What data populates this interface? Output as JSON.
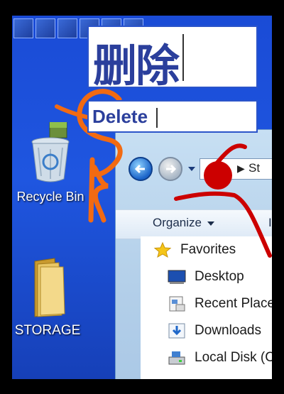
{
  "desktop": {
    "recycle_bin_label": "Recycle Bin",
    "storage_label": "STORAGE"
  },
  "overlay": {
    "chinese_label": "删除",
    "english_label": "Delete"
  },
  "explorer": {
    "address_text": "St",
    "toolbar": {
      "organize_label": "Organize",
      "include_label": "In"
    },
    "nav_pane": {
      "items": [
        {
          "label": "Favorites",
          "icon": "star-icon"
        },
        {
          "label": "Desktop",
          "icon": "desktop-icon"
        },
        {
          "label": "Recent Places",
          "icon": "recent-places-icon"
        },
        {
          "label": "Downloads",
          "icon": "downloads-icon"
        },
        {
          "label": "Local Disk (C:)",
          "icon": "local-disk-icon"
        }
      ]
    }
  },
  "colors": {
    "desktop_bg": "#1f56e0",
    "overlay_text": "#2b3f9c",
    "annotation_orange": "#f26a12",
    "annotation_red": "#cc0000"
  }
}
